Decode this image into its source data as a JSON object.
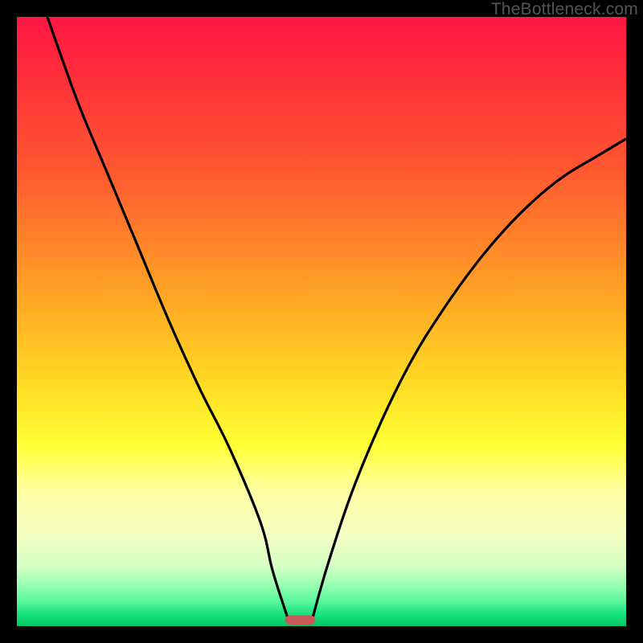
{
  "watermark": "TheBottleneck.com",
  "chart_data": {
    "type": "line",
    "title": "",
    "xlabel": "",
    "ylabel": "",
    "xlim": [
      0,
      100
    ],
    "ylim": [
      0,
      100
    ],
    "series": [
      {
        "name": "left-curve",
        "x": [
          5,
          10,
          15,
          20,
          25,
          30,
          35,
          40,
          42,
          44.5
        ],
        "values": [
          100,
          86,
          74,
          62,
          50,
          39,
          29,
          17,
          9,
          1.2
        ]
      },
      {
        "name": "right-curve",
        "x": [
          48.5,
          51,
          55,
          60,
          65,
          70,
          75,
          80,
          85,
          90,
          95,
          100
        ],
        "values": [
          1.2,
          10,
          22,
          34,
          44,
          52,
          59,
          65,
          70,
          74,
          77,
          80
        ]
      }
    ],
    "marker": {
      "x_center": 46.5,
      "width_pct": 5.0,
      "height_pct": 1.5,
      "y_pct": 1.0
    },
    "colors": {
      "gradient_top": "#ff1744",
      "gradient_mid": "#ffff33",
      "gradient_bottom": "#00c765",
      "curve": "#000000",
      "marker": "#c85a57",
      "frame_border": "#000000"
    }
  }
}
